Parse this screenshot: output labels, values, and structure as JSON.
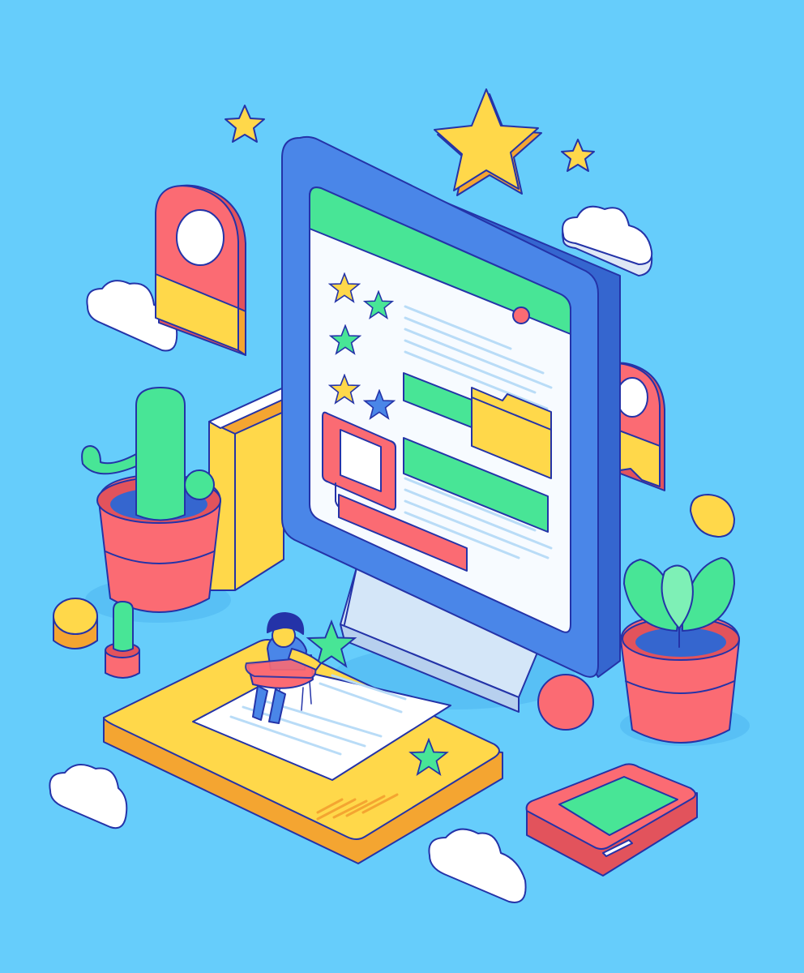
{
  "scene": {
    "kind": "isometric illustration",
    "background": "#66cdfb"
  },
  "palette": {
    "monitor_frame": "#4a86e8",
    "monitor_side": "#3566cf",
    "screen": "#f7fbff",
    "header_bar": "#48e596",
    "green": "#48e596",
    "yellow": "#ffd84a",
    "red": "#fb6b73",
    "cloud": "#ffffff",
    "outline": "#2433a8"
  },
  "screen": {
    "rating_rows": [
      [
        "star-yellow",
        "star-green"
      ],
      [
        "star-green"
      ],
      [
        "star-yellow",
        "star-blue"
      ]
    ],
    "icons": [
      "folder-icon",
      "image-placeholder-icon",
      "close-dot-icon"
    ]
  },
  "decor": {
    "icons": [
      "location-pin-icon",
      "cactus-icon",
      "succulent-icon",
      "star-icon",
      "cloud-icon",
      "book-icon",
      "tablet-icon",
      "person-icon",
      "chair-icon"
    ]
  }
}
